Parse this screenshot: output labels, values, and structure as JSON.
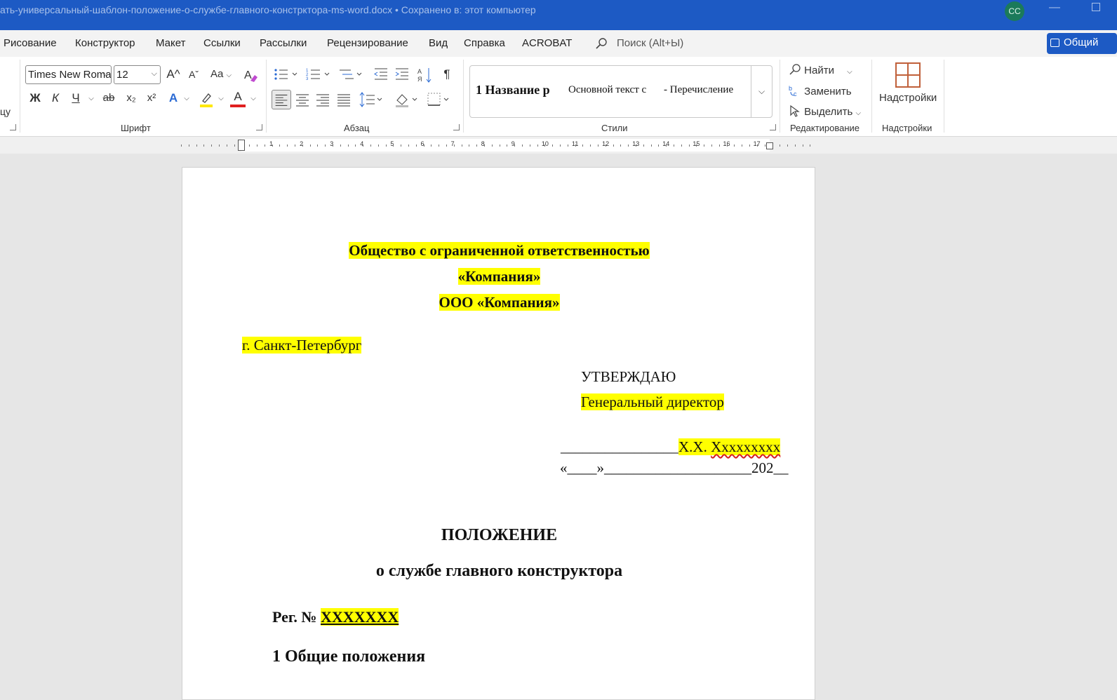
{
  "titlebar": {
    "title": "ать-универсальный-шаблон-положение-о-службе-главного-констрктора-ms-word.docx • Сохранено в: этот компьютер ",
    "avatar_initials": "CC",
    "accent_color": "#1d5ac4"
  },
  "menu": {
    "items": [
      "Рисование",
      "Конструктор",
      "Макет",
      "Ссылки",
      "Рассылки",
      "Рецензирование",
      "Вид",
      "Справка",
      "ACROBAT"
    ],
    "search_placeholder": "Поиск (Alt+Ы)",
    "share_label": "Общий"
  },
  "ribbon": {
    "font": {
      "name": "Times New Roman",
      "size": "12",
      "group_label": "Шрифт",
      "case_button": "Aa",
      "bold": "Ж",
      "italic": "К",
      "underline": "Ч",
      "strike": "ab",
      "subscript": "x₂",
      "superscript": "x²",
      "grow": "A^",
      "shrink": "Aˇ",
      "effects": "A",
      "color": "A",
      "left_partial": "цу"
    },
    "paragraph": {
      "group_label": "Абзац",
      "pilcrow": "¶"
    },
    "styles": {
      "group_label": "Стили",
      "items": [
        "1  Название р",
        "Основной текст с",
        "-  Перечисление"
      ]
    },
    "editing": {
      "group_label": "Редактирование",
      "find": "Найти",
      "replace": "Заменить",
      "select": "Выделить"
    },
    "addins": {
      "button_label": "Надстройки",
      "group_label": "Надстройки"
    }
  },
  "ruler": {
    "numbers": [
      "1",
      "2",
      "3",
      "4",
      "5",
      "6",
      "7",
      "8",
      "9",
      "10",
      "11",
      "12",
      "13",
      "14",
      "15",
      "16",
      "17"
    ]
  },
  "document": {
    "org_line1": "Общество с ограниченной ответственностью",
    "org_line2": "«Компания»",
    "org_line3": "ООО «Компания»",
    "city": "г. Санкт-Петербург",
    "approve": "УТВЕРЖДАЮ",
    "director": "Генеральный директор",
    "signature_line": "________________",
    "signature_name": "Х.Х. Ххххххххх",
    "date_line": "«____»____________________202__",
    "title": "ПОЛОЖЕНИЕ",
    "subtitle": "о службе главного конструктора",
    "reg_label": "Рег. № ",
    "reg_value": "ХХХХХХХ",
    "section1": "1  Общие положения",
    "highlight_color": "#ffff00"
  }
}
